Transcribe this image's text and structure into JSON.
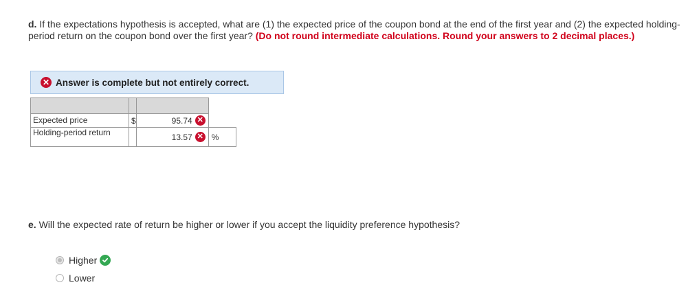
{
  "question_d": {
    "label": "d.",
    "text": " If the expectations hypothesis is accepted, what are (1) the expected price of the coupon bond at the end of the first year and (2) the expected holding-period return on the coupon bond over the first year? ",
    "instruction": "(Do not round intermediate calculations. Round your answers to 2 decimal places.)"
  },
  "banner": {
    "text": "Answer is complete but not entirely correct.",
    "icon": "x-circle-icon",
    "color": "#c8102e"
  },
  "answer_table": {
    "rows": [
      {
        "label": "Expected price",
        "prefix": "$",
        "value": "95.74",
        "suffix": ""
      },
      {
        "label": "Holding-period return",
        "prefix": "",
        "value": "13.57",
        "suffix": "%"
      }
    ]
  },
  "question_e": {
    "label": "e.",
    "text": " Will the expected rate of return be higher or lower if you accept the liquidity preference hypothesis?"
  },
  "options": [
    {
      "label": "Higher",
      "selected": true,
      "status": "correct"
    },
    {
      "label": "Lower",
      "selected": false,
      "status": ""
    }
  ]
}
